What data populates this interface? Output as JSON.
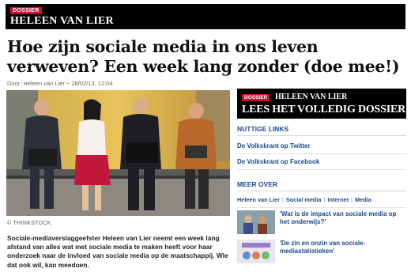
{
  "banner": {
    "tag": "DOSSIER",
    "title": "HELEEN VAN LIER"
  },
  "article": {
    "headline": "Hoe zijn sociale media in ons leven verweven? Een week lang zonder (doe mee!)",
    "byline": "Door: Heleen van Lier − 28/02/13, 12:04",
    "photo_caption": "© THINKSTOCK.",
    "intro": "Sociale-mediaverslaggeefster Heleen van Lier neemt een week lang afstand van alles wat met sociale media te maken heeft voor haar onderzoek naar de invloed van sociale media op de maatschappij. Wie dat ook wil, kan meedoen."
  },
  "sidebar": {
    "promo": {
      "tag": "DOSSIER",
      "name": "HELEEN VAN LIER",
      "cta": "LEES HET VOLLEDIG DOSSIER »"
    },
    "useful_links": {
      "title": "NUTTIGE LINKS",
      "items": [
        "De Volkskrant op Twitter",
        "De Volkskrant op Facebook"
      ]
    },
    "more": {
      "title": "MEER OVER",
      "tags": [
        "Heleen van Lier",
        "Social media",
        "Internet",
        "Media"
      ],
      "related": [
        {
          "title": "'Wat is de impact van sociale media op het onderwijs?'"
        },
        {
          "title": "'De zin en onzin van sociale-mediastatistieken'"
        }
      ]
    }
  },
  "colors": {
    "banner_bg": "#000000",
    "tag_red": "#c8102e",
    "link_blue": "#1a4a8a"
  }
}
